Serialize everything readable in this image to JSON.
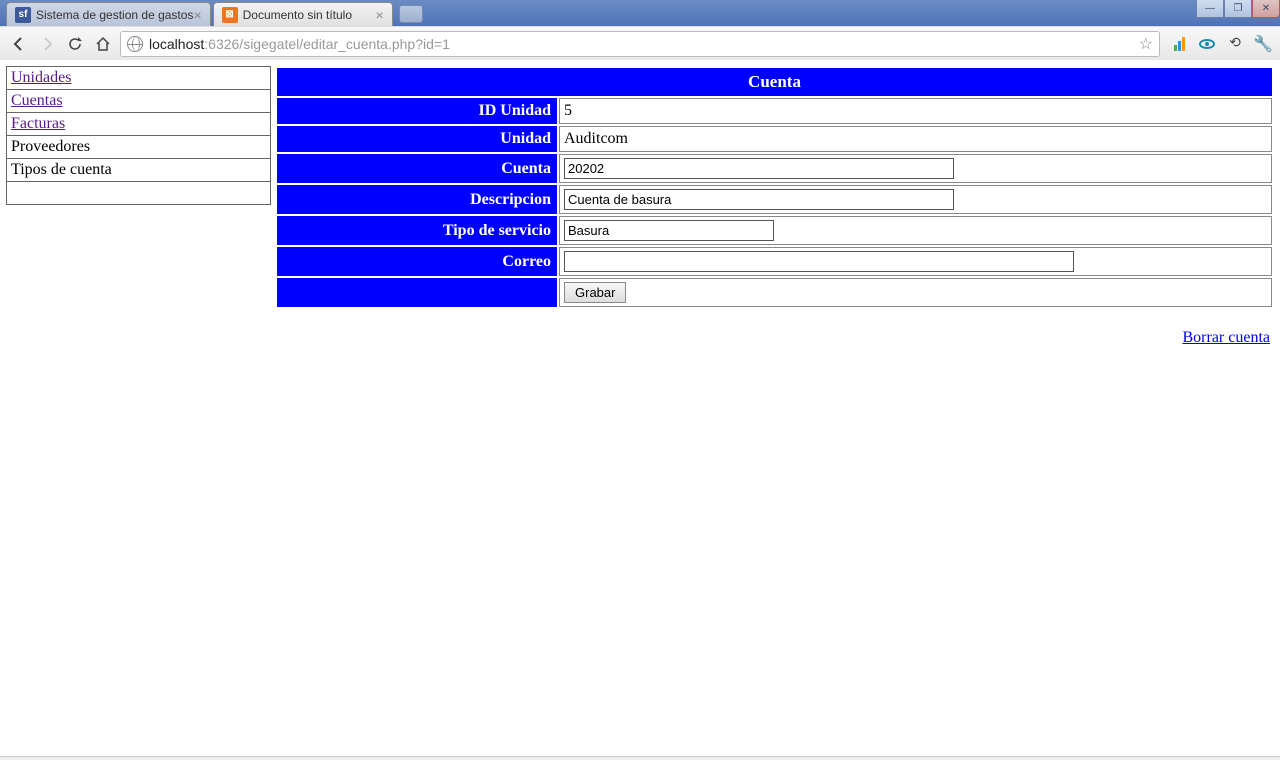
{
  "browser": {
    "tabs": [
      {
        "title": "Sistema de gestion de gastos",
        "favicon": "sf"
      },
      {
        "title": "Documento sin título",
        "favicon": "xa"
      }
    ],
    "url_host": "localhost",
    "url_rest": ":6326/sigegatel/editar_cuenta.php?id=1"
  },
  "sidebar": {
    "items": [
      {
        "label": "Unidades",
        "visited": true
      },
      {
        "label": "Cuentas",
        "visited": true
      },
      {
        "label": "Facturas",
        "visited": true
      },
      {
        "label": "Proveedores",
        "visited": false
      },
      {
        "label": "Tipos de cuenta",
        "visited": false
      },
      {
        "label": "",
        "visited": false
      }
    ]
  },
  "form": {
    "title": "Cuenta",
    "labels": {
      "id_unidad": "ID Unidad",
      "unidad": "Unidad",
      "cuenta": "Cuenta",
      "descripcion": "Descripcion",
      "tipo_servicio": "Tipo de servicio",
      "correo": "Correo"
    },
    "values": {
      "id_unidad": "5",
      "unidad": "Auditcom",
      "cuenta": "20202",
      "descripcion": "Cuenta de basura",
      "tipo_servicio": "Basura",
      "correo": ""
    },
    "submit_label": "Grabar",
    "delete_label": "Borrar cuenta"
  }
}
